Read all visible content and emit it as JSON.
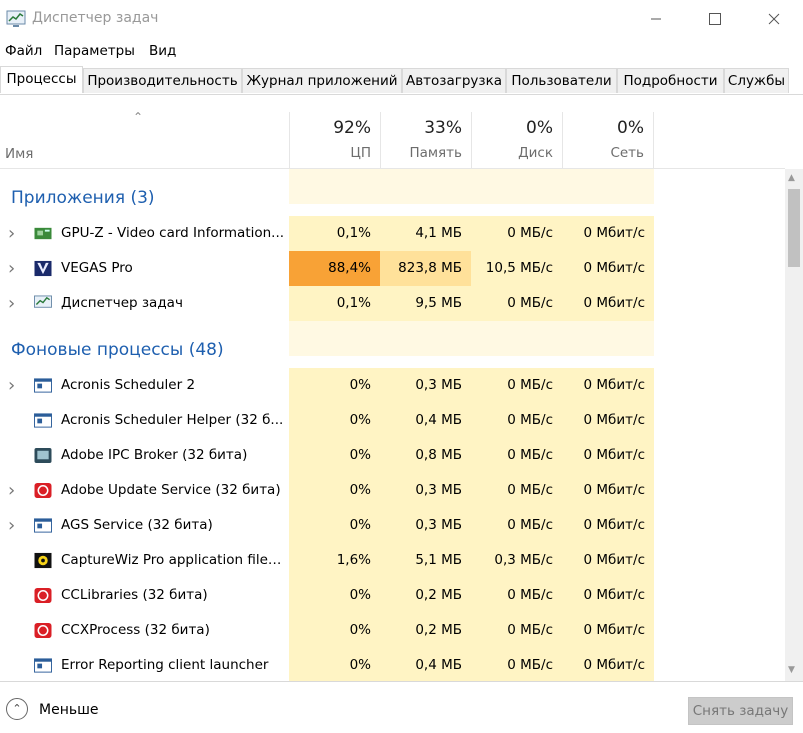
{
  "window": {
    "title": "Диспетчер задач"
  },
  "menu": [
    "Файл",
    "Параметры",
    "Вид"
  ],
  "tabs": [
    "Процессы",
    "Производительность",
    "Журнал приложений",
    "Автозагрузка",
    "Пользователи",
    "Подробности",
    "Службы"
  ],
  "active_tab": 0,
  "columns": {
    "name": "Имя",
    "cpu": {
      "pct": "92%",
      "label": "ЦП"
    },
    "mem": {
      "pct": "33%",
      "label": "Память"
    },
    "disk": {
      "pct": "0%",
      "label": "Диск"
    },
    "net": {
      "pct": "0%",
      "label": "Сеть"
    }
  },
  "colors": {
    "accent": "#1e5faf",
    "heat_low": "#fff4c4",
    "heat_mid": "#ffe19a",
    "heat_high": "#f8a236",
    "heat_empty": "#fff9e3"
  },
  "rows": [
    {
      "type": "group",
      "label": "Приложения (3)"
    },
    {
      "type": "proc",
      "expand": true,
      "icon": "gpuz-icon",
      "name": "GPU-Z - Video card Information...",
      "cpu": "0,1%",
      "mem": "4,1 МБ",
      "disk": "0 МБ/с",
      "net": "0 Мбит/с",
      "heat": [
        "low",
        "low",
        "low",
        "low"
      ]
    },
    {
      "type": "proc",
      "expand": true,
      "icon": "vegas-icon",
      "name": "VEGAS Pro",
      "cpu": "88,4%",
      "mem": "823,8 МБ",
      "disk": "10,5 МБ/с",
      "net": "0 Мбит/с",
      "heat": [
        "high",
        "mid",
        "low",
        "low"
      ]
    },
    {
      "type": "proc",
      "expand": true,
      "icon": "task-manager-icon",
      "name": "Диспетчер задач",
      "cpu": "0,1%",
      "mem": "9,5 МБ",
      "disk": "0 МБ/с",
      "net": "0 Мбит/с",
      "heat": [
        "low",
        "low",
        "low",
        "low"
      ]
    },
    {
      "type": "group",
      "label": "Фоновые процессы (48)"
    },
    {
      "type": "proc",
      "expand": true,
      "icon": "app-window-icon",
      "name": "Acronis Scheduler 2",
      "cpu": "0%",
      "mem": "0,3 МБ",
      "disk": "0 МБ/с",
      "net": "0 Мбит/с",
      "heat": [
        "low",
        "low",
        "low",
        "low"
      ]
    },
    {
      "type": "proc",
      "expand": false,
      "icon": "app-window-icon",
      "name": "Acronis Scheduler Helper (32 б...",
      "cpu": "0%",
      "mem": "0,4 МБ",
      "disk": "0 МБ/с",
      "net": "0 Мбит/с",
      "heat": [
        "low",
        "low",
        "low",
        "low"
      ]
    },
    {
      "type": "proc",
      "expand": false,
      "icon": "adobe-ipc-icon",
      "name": "Adobe IPC Broker (32 бита)",
      "cpu": "0%",
      "mem": "0,8 МБ",
      "disk": "0 МБ/с",
      "net": "0 Мбит/с",
      "heat": [
        "low",
        "low",
        "low",
        "low"
      ]
    },
    {
      "type": "proc",
      "expand": true,
      "icon": "adobe-cc-icon",
      "name": "Adobe Update Service (32 бита)",
      "cpu": "0%",
      "mem": "0,3 МБ",
      "disk": "0 МБ/с",
      "net": "0 Мбит/с",
      "heat": [
        "low",
        "low",
        "low",
        "low"
      ]
    },
    {
      "type": "proc",
      "expand": true,
      "icon": "app-window-icon",
      "name": "AGS Service (32 бита)",
      "cpu": "0%",
      "mem": "0,3 МБ",
      "disk": "0 МБ/с",
      "net": "0 Мбит/с",
      "heat": [
        "low",
        "low",
        "low",
        "low"
      ]
    },
    {
      "type": "proc",
      "expand": false,
      "icon": "capturewiz-icon",
      "name": "CaptureWiz Pro application file ...",
      "cpu": "1,6%",
      "mem": "5,1 МБ",
      "disk": "0,3 МБ/с",
      "net": "0 Мбит/с",
      "heat": [
        "low",
        "low",
        "low",
        "low"
      ]
    },
    {
      "type": "proc",
      "expand": false,
      "icon": "adobe-cc-icon",
      "name": "CCLibraries (32 бита)",
      "cpu": "0%",
      "mem": "0,2 МБ",
      "disk": "0 МБ/с",
      "net": "0 Мбит/с",
      "heat": [
        "low",
        "low",
        "low",
        "low"
      ]
    },
    {
      "type": "proc",
      "expand": false,
      "icon": "adobe-cc-icon",
      "name": "CCXProcess (32 бита)",
      "cpu": "0%",
      "mem": "0,2 МБ",
      "disk": "0 МБ/с",
      "net": "0 Мбит/с",
      "heat": [
        "low",
        "low",
        "low",
        "low"
      ]
    },
    {
      "type": "proc",
      "expand": false,
      "icon": "app-window-icon",
      "name": "Error Reporting client launcher",
      "cpu": "0%",
      "mem": "0,4 МБ",
      "disk": "0 МБ/с",
      "net": "0 Мбит/с",
      "heat": [
        "low",
        "low",
        "low",
        "low"
      ]
    }
  ],
  "footer": {
    "less_label": "Меньше",
    "end_task_label": "Снять задачу"
  }
}
